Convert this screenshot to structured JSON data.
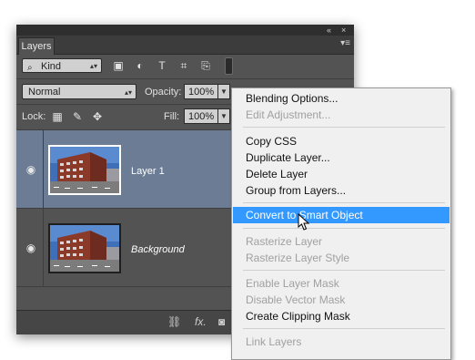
{
  "panel": {
    "collapse_glyph": "«",
    "close_glyph": "×",
    "tab_label": "Layers",
    "menu_glyph": "▾≡"
  },
  "filter": {
    "kind_label": "Kind",
    "icons": [
      "image-filter-icon",
      "adjustment-filter-icon",
      "type-filter-icon",
      "shape-filter-icon",
      "smart-object-filter-icon"
    ],
    "icon_glyphs": [
      "▣",
      "◐",
      "T",
      "⌗",
      "⎘"
    ]
  },
  "blend": {
    "mode": "Normal",
    "opacity_label": "Opacity:",
    "opacity_value": "100%"
  },
  "lock": {
    "label": "Lock:",
    "fill_label": "Fill:",
    "fill_value": "100%",
    "icon_glyphs": [
      "▦",
      "✎",
      "✥",
      "🔒"
    ]
  },
  "layers": [
    {
      "name": "Layer 1",
      "selected": true
    },
    {
      "name": "Background",
      "selected": false
    }
  ],
  "bottom": {
    "icon_glyphs": [
      "⛓",
      "fx.",
      "◙"
    ]
  },
  "context_menu": {
    "groups": [
      [
        {
          "label": "Blending Options...",
          "disabled": false
        },
        {
          "label": "Edit Adjustment...",
          "disabled": true
        }
      ],
      [
        {
          "label": "Copy CSS",
          "disabled": false
        },
        {
          "label": "Duplicate Layer...",
          "disabled": false
        },
        {
          "label": "Delete Layer",
          "disabled": false
        },
        {
          "label": "Group from Layers...",
          "disabled": false
        }
      ],
      [
        {
          "label": "Convert to Smart Object",
          "disabled": false,
          "highlighted": true
        }
      ],
      [
        {
          "label": "Rasterize Layer",
          "disabled": true
        },
        {
          "label": "Rasterize Layer Style",
          "disabled": true
        }
      ],
      [
        {
          "label": "Enable Layer Mask",
          "disabled": true
        },
        {
          "label": "Disable Vector Mask",
          "disabled": true
        },
        {
          "label": "Create Clipping Mask",
          "disabled": false
        }
      ],
      [
        {
          "label": "Link Layers",
          "disabled": true
        }
      ]
    ]
  },
  "colors": {
    "panel_bg": "#535353",
    "selected_layer": "#6b7c94",
    "menu_highlight": "#3399ff",
    "menu_bg": "#f0f0f0"
  }
}
